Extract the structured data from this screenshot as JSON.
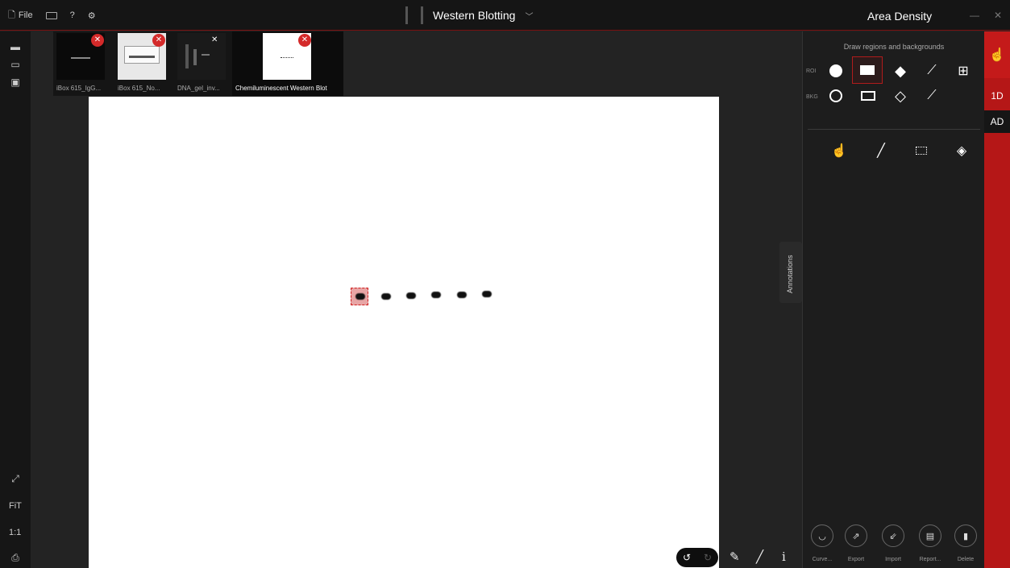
{
  "topbar": {
    "file_label": "File",
    "help_label": "?",
    "title": "Western Blotting",
    "panel_title": "Area Density",
    "minimize": "—",
    "close": "✕"
  },
  "thumbnails": [
    {
      "label": "iBox 615_IgG..."
    },
    {
      "label": "iBox 615_No..."
    },
    {
      "label": "DNA_gel_inv..."
    },
    {
      "label": "Chemiluminescent Western Blot"
    }
  ],
  "left_toolbar": {
    "fit_label": "FiT",
    "one_to_one_label": "1:1"
  },
  "annotations_tab": "Annotations",
  "right_panel": {
    "heading": "Draw regions and backgrounds",
    "roi_label": "ROI",
    "bkg_label": "BKG",
    "actions": [
      {
        "label": "Curve..."
      },
      {
        "label": "Export"
      },
      {
        "label": "Import"
      },
      {
        "label": "Report..."
      },
      {
        "label": "Delete"
      }
    ]
  },
  "right_strip": {
    "tab_1d": "1D",
    "tab_ad": "AD"
  },
  "colors": {
    "accent": "#b51717",
    "background": "#232323"
  }
}
